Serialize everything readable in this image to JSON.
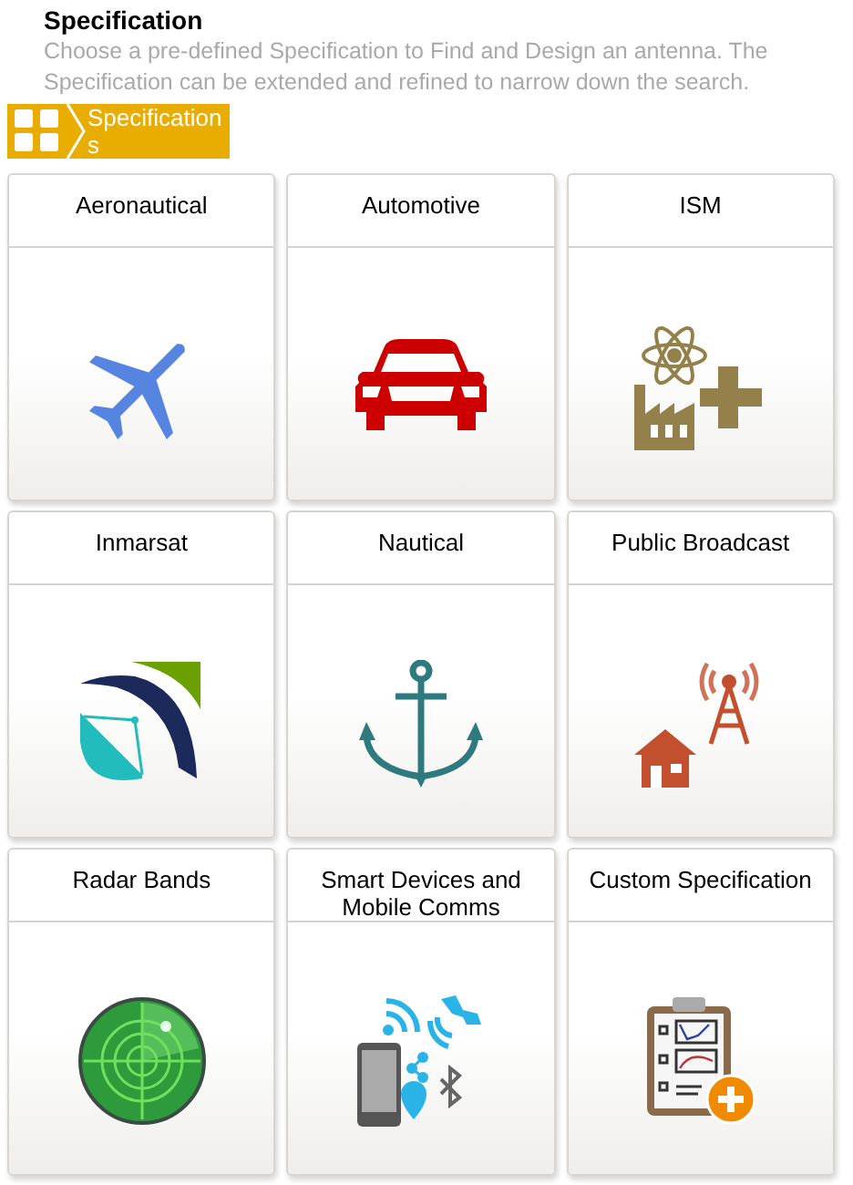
{
  "header": {
    "title": "Specification",
    "description": "Choose a pre-defined Specification to Find and Design an antenna. The Specification can be extended and refined to narrow down the search."
  },
  "breadcrumb": {
    "label": "Specifications"
  },
  "cards": [
    {
      "label": "Aeronautical",
      "kind": "airplane"
    },
    {
      "label": "Automotive",
      "kind": "car"
    },
    {
      "label": "ISM",
      "kind": "ism"
    },
    {
      "label": "Inmarsat",
      "kind": "inmarsat"
    },
    {
      "label": "Nautical",
      "kind": "anchor"
    },
    {
      "label": "Public Broadcast",
      "kind": "broadcast"
    },
    {
      "label": "Radar Bands",
      "kind": "radar"
    },
    {
      "label": "Smart Devices and Mobile Comms",
      "kind": "devices"
    },
    {
      "label": "Custom Specification",
      "kind": "custom"
    }
  ]
}
